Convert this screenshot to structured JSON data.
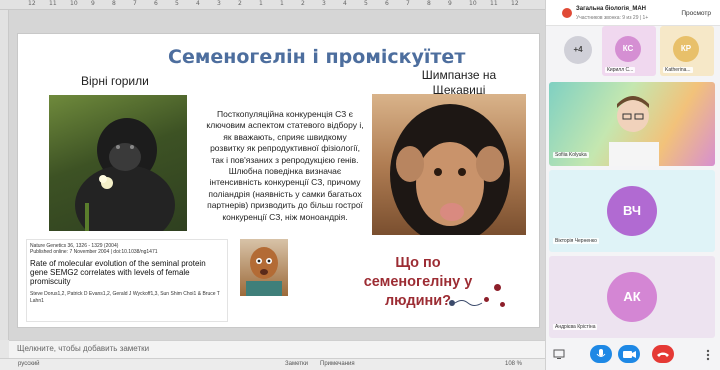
{
  "ruler": {
    "ticks": [
      "12",
      "11",
      "10",
      "9",
      "8",
      "7",
      "6",
      "5",
      "4",
      "3",
      "2",
      "1",
      "1",
      "2",
      "3",
      "4",
      "5",
      "6",
      "7",
      "8",
      "9",
      "10",
      "11",
      "12"
    ]
  },
  "slide": {
    "title": "Семеногелін і проміскуїтет",
    "left_label": "Вірні горили",
    "right_label": "Шимпанзе на Щекавиці",
    "body": "Посткопуляційна конкуренція СЗ є ключовим аспектом статевого відбору і, як вважають, сприяє швидкому розвитку як репродуктивної фізіології, так і пов'язаних з репродукцією генів. Шлюбна поведінка визначає інтенсивність конкуренції СЗ, причому поліандрія (наявність у самки багатьох партнерів) призводить до більш гострої конкуренції СЗ, ніж моноандрія.",
    "paper": {
      "journal": "Nature Genetics 36, 1326 - 1329 (2004)",
      "published": "Published online: 7 November 2004 | doi:10.1038/ng1471",
      "title": "Rate of molecular evolution of the seminal protein gene SEMG2 correlates with levels of female promiscuity",
      "authors": "Steve Dorus1,2, Patrick D Evans1,2, Gerald J Wyckoff1,3, Sun Shim Choi1 & Bruce T Lahn1"
    },
    "question": "Що по семеногеліну у людини?"
  },
  "notes": {
    "placeholder": "Щелкните, чтобы добавить заметки"
  },
  "status": {
    "language": "русский",
    "notes": "Заметки",
    "comments": "Примечания",
    "zoom": "108 %"
  },
  "call": {
    "title": "Загальна біологія_МАН",
    "subtitle": "Участников звонка: 9 из 29 | 1+",
    "view": "Просмотр",
    "more_count": "+4",
    "participants": [
      {
        "initials": "КС",
        "name": "Кирилл С...",
        "color": "#d58fd3"
      },
      {
        "initials": "КР",
        "name": "Katherina...",
        "color": "#e8c06a"
      },
      {
        "initials": "",
        "name": "Sofiia Kolyuka",
        "color": "#9ed3c8"
      },
      {
        "initials": "ВЧ",
        "name": "Вікторія Черненко",
        "color": "#b16ad2"
      },
      {
        "initials": "АК",
        "name": "Андрієва Крістіна",
        "color": "#d486d4"
      }
    ]
  },
  "colors": {
    "title": "#4d6e9e",
    "question": "#9c2c33",
    "mic": "#1e88e5",
    "cam": "#1e88e5",
    "hangup": "#e53935"
  }
}
